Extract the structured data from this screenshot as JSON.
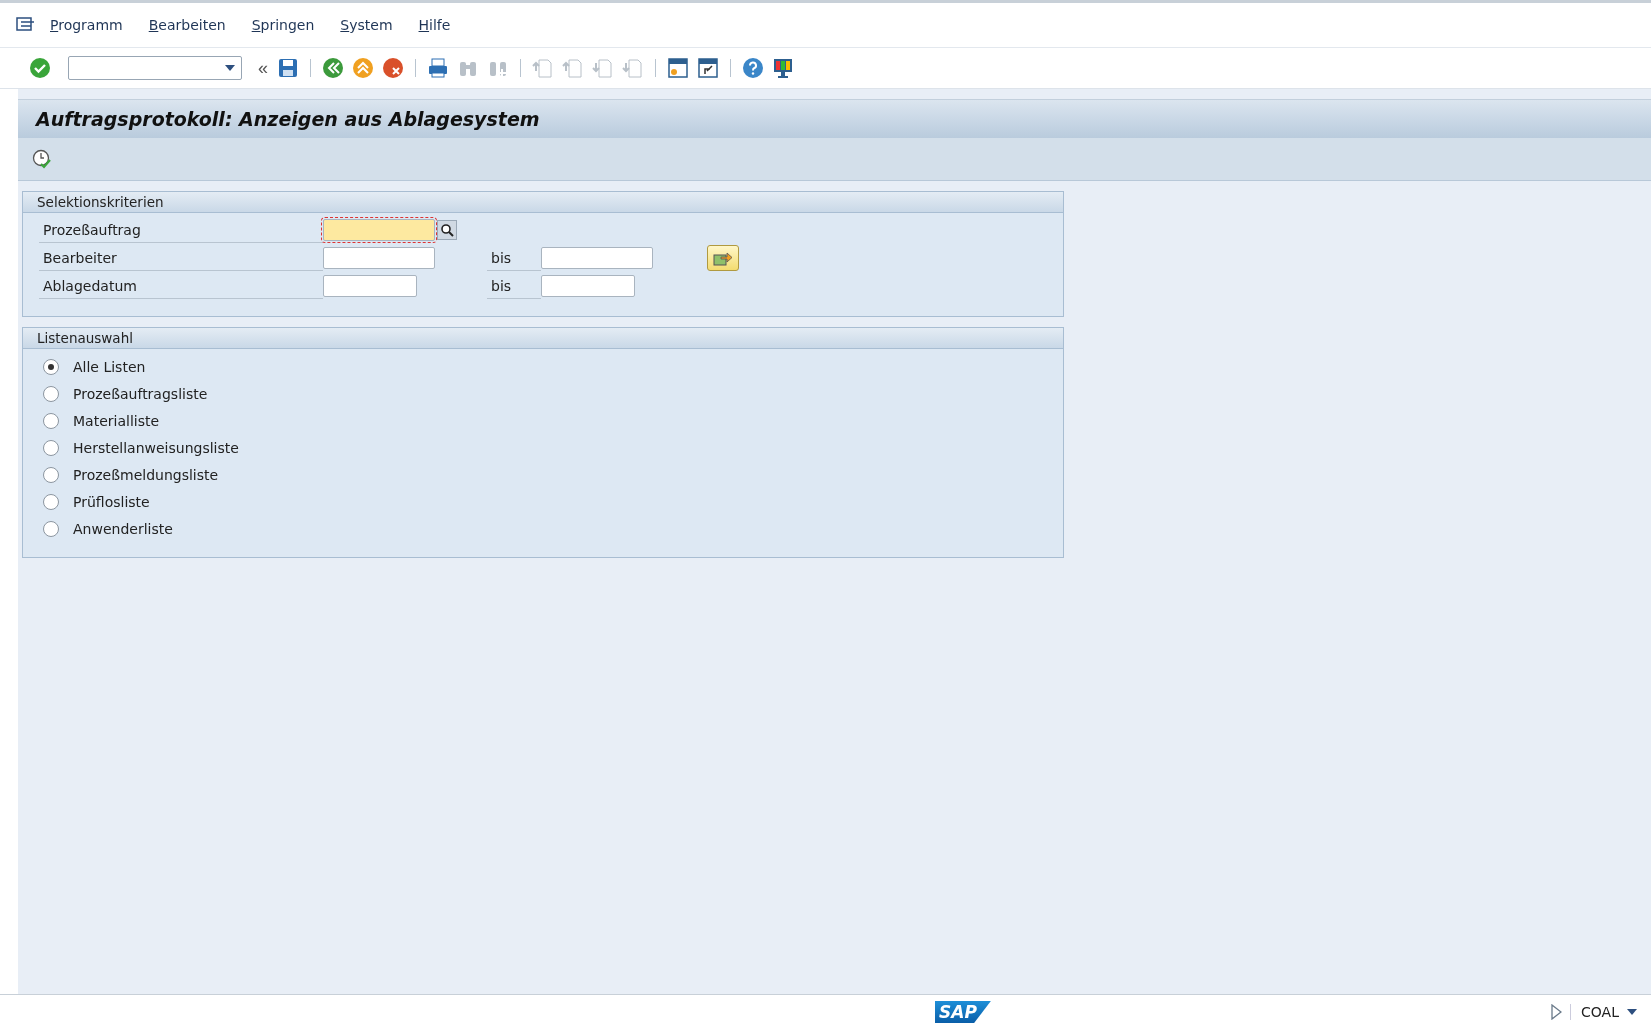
{
  "menu": [
    {
      "label": "Programm"
    },
    {
      "label": "Bearbeiten"
    },
    {
      "label": "Springen"
    },
    {
      "label": "System"
    },
    {
      "label": "Hilfe"
    }
  ],
  "toolbar": [
    {
      "kind": "enter",
      "disabled": false
    },
    {
      "kind": "command"
    },
    {
      "kind": "collapse",
      "text": "«"
    },
    {
      "kind": "save",
      "disabled": false
    },
    {
      "kind": "sep"
    },
    {
      "kind": "back",
      "disabled": false
    },
    {
      "kind": "exit",
      "disabled": false
    },
    {
      "kind": "cancel",
      "disabled": false
    },
    {
      "kind": "sep"
    },
    {
      "kind": "print",
      "disabled": false
    },
    {
      "kind": "find",
      "disabled": true
    },
    {
      "kind": "findnext",
      "disabled": true
    },
    {
      "kind": "sep"
    },
    {
      "kind": "first",
      "disabled": true
    },
    {
      "kind": "prev",
      "disabled": true
    },
    {
      "kind": "next",
      "disabled": true
    },
    {
      "kind": "last",
      "disabled": true
    },
    {
      "kind": "sep"
    },
    {
      "kind": "session",
      "disabled": false
    },
    {
      "kind": "shortcut",
      "disabled": false
    },
    {
      "kind": "sep"
    },
    {
      "kind": "help",
      "disabled": false
    },
    {
      "kind": "layout",
      "disabled": false
    }
  ],
  "title": "Auftragsprotokoll: Anzeigen aus Ablagesystem",
  "selection": {
    "title": "Selektionskriterien",
    "rows": [
      {
        "label": "Prozeßauftrag",
        "kind": "text",
        "focused": true,
        "search_help": true
      },
      {
        "label": "Bearbeiter",
        "kind": "text",
        "focused": false,
        "search_help": false,
        "to_label": "bis",
        "multiple": true
      },
      {
        "label": "Ablagedatum",
        "kind": "date",
        "focused": false,
        "search_help": false,
        "to_label": "bis",
        "multiple": false
      }
    ]
  },
  "lists": {
    "title": "Listenauswahl",
    "options": [
      {
        "label": "Alle Listen",
        "selected": true
      },
      {
        "label": "Prozeßauftragsliste",
        "selected": false
      },
      {
        "label": "Materialliste",
        "selected": false
      },
      {
        "label": "Herstellanweisungsliste",
        "selected": false
      },
      {
        "label": "Prozeßmeldungsliste",
        "selected": false
      },
      {
        "label": "Prüflosliste",
        "selected": false
      },
      {
        "label": "Anwenderliste",
        "selected": false
      }
    ]
  },
  "status_bar": {
    "logo": "SAP",
    "system": "COAL"
  }
}
